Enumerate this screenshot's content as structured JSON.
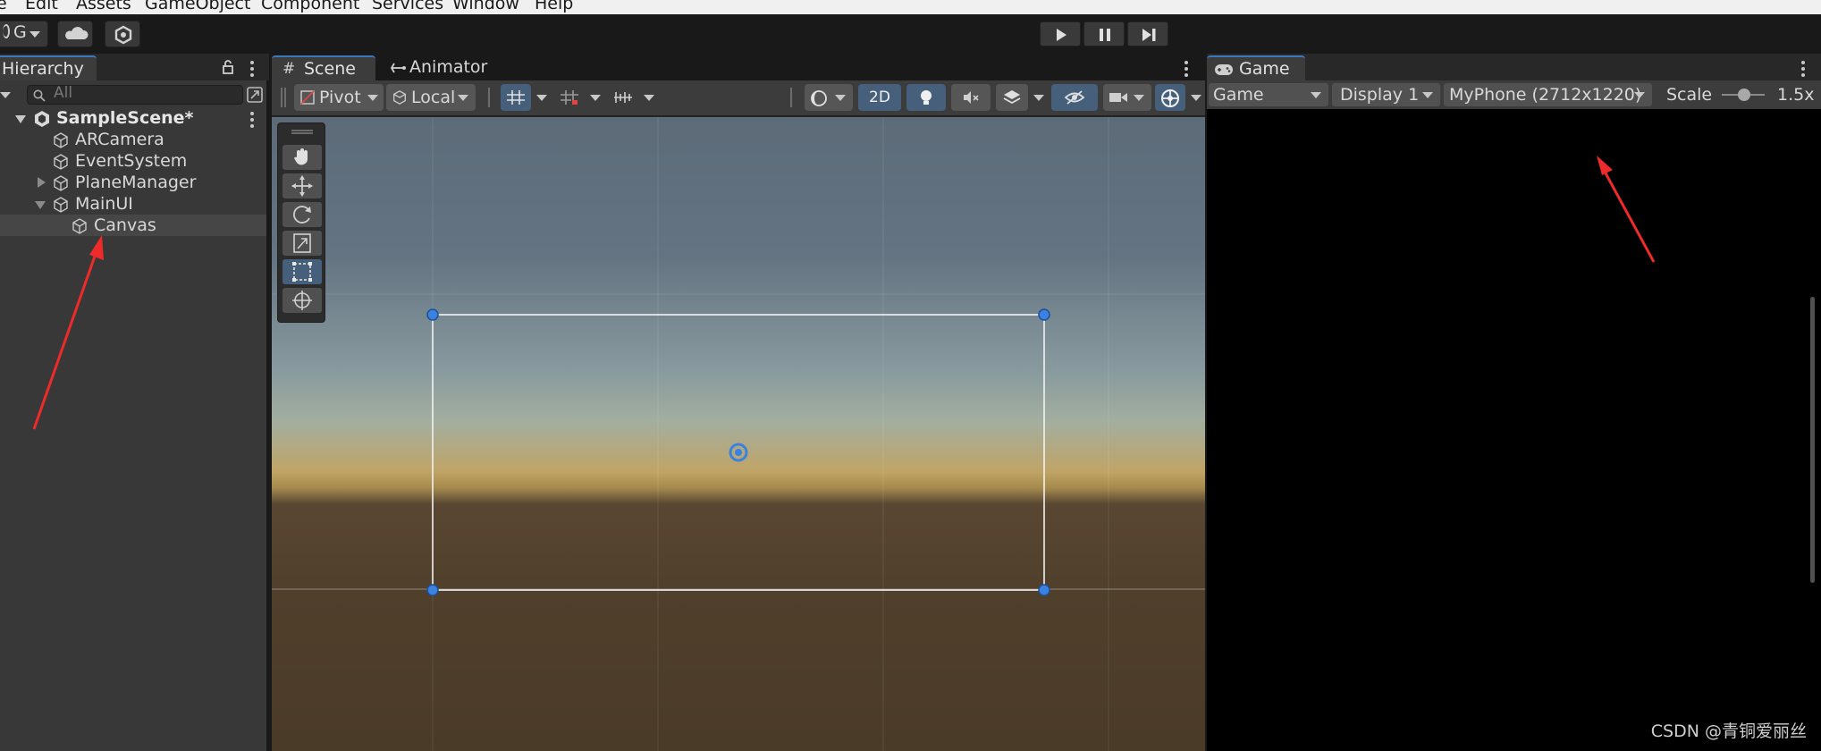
{
  "menu": [
    "Edit",
    "Assets",
    "GameObject",
    "Component",
    "Services",
    "Window",
    "Help"
  ],
  "toolbar": {
    "account_letter": "G"
  },
  "hierarchy": {
    "tab_label": "Hierarchy",
    "search_placeholder": "All",
    "scene_name": "SampleScene*",
    "items": [
      {
        "label": "ARCamera"
      },
      {
        "label": "EventSystem"
      },
      {
        "label": "PlaneManager"
      },
      {
        "label": "MainUI"
      },
      {
        "label": "Canvas"
      }
    ]
  },
  "scene": {
    "tab_scene": "Scene",
    "tab_animator": "Animator",
    "pivot_label": "Pivot",
    "local_label": "Local",
    "mode_2d": "2D"
  },
  "game": {
    "tab_label": "Game",
    "view_select": "Game",
    "display_select": "Display 1",
    "resolution_select": "MyPhone (2712x1220)",
    "scale_label": "Scale",
    "scale_value": "1.5x"
  },
  "watermark": "CSDN @青铜爱丽丝",
  "colors": {
    "accent": "#3a79bb",
    "annotation_arrow": "#ee2a2a",
    "handle": "#3b82e0"
  }
}
